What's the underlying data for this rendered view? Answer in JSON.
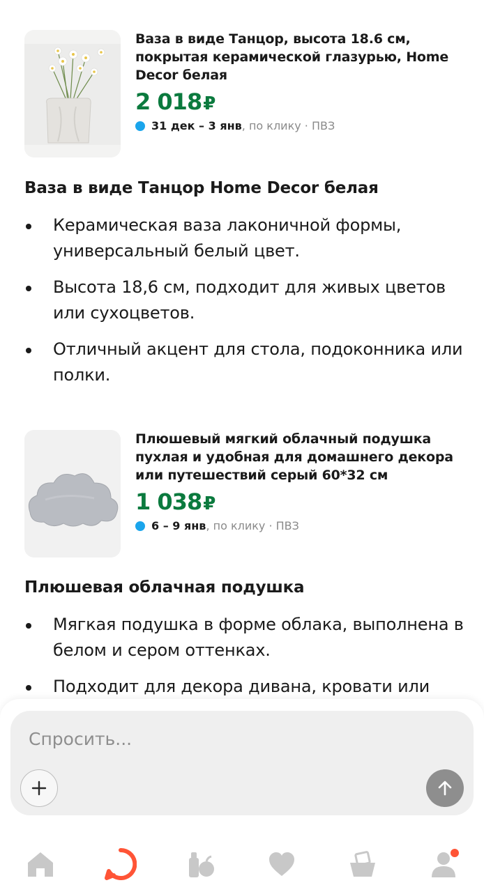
{
  "products": [
    {
      "title": "Ваза в виде Танцор, высота 18.6 см, покрытая керамической глазурью, Home Decor белая",
      "price": "2 018",
      "currency": "₽",
      "delivery_dates": "31 дек – 3 янв",
      "delivery_suffix": ", по клику · ПВЗ",
      "image_icon": "vase-photo"
    },
    {
      "title": "Плюшевый мягкий облачный подушка пухлая и удобная для домашнего декора или путешествий серый 60*32 см",
      "price": "1 038",
      "currency": "₽",
      "delivery_dates": "6 – 9 янв",
      "delivery_suffix": ", по клику · ПВЗ",
      "image_icon": "cloud-pillow-photo"
    }
  ],
  "descriptions": [
    {
      "title": "Ваза в виде Танцор Home Decor белая",
      "bullets": [
        "Керамическая ваза лаконичной формы, универсальный белый цвет.",
        "Высота 18,6 см, подходит для живых цветов или сухоцветов.",
        "Отличный акцент для стола, подоконника или полки."
      ]
    },
    {
      "title": "Плюшевая облачная подушка",
      "bullets": [
        "Мягкая подушка в форме облака, выполнена в белом и сером оттенках.",
        "Подходит для декора дивана, кровати или"
      ]
    }
  ],
  "ask": {
    "placeholder": "Спросить...",
    "plus_icon": "plus-icon",
    "send_icon": "arrow-up-icon"
  },
  "nav": {
    "items": [
      "home-icon",
      "alice-icon",
      "grocery-icon",
      "heart-icon",
      "basket-icon",
      "profile-icon"
    ]
  },
  "colors": {
    "price": "#0b7a3e",
    "delivery_dot": "#1aa5ec",
    "alice_accent": "#ff5436",
    "nav_icon": "#c8c8c8"
  }
}
